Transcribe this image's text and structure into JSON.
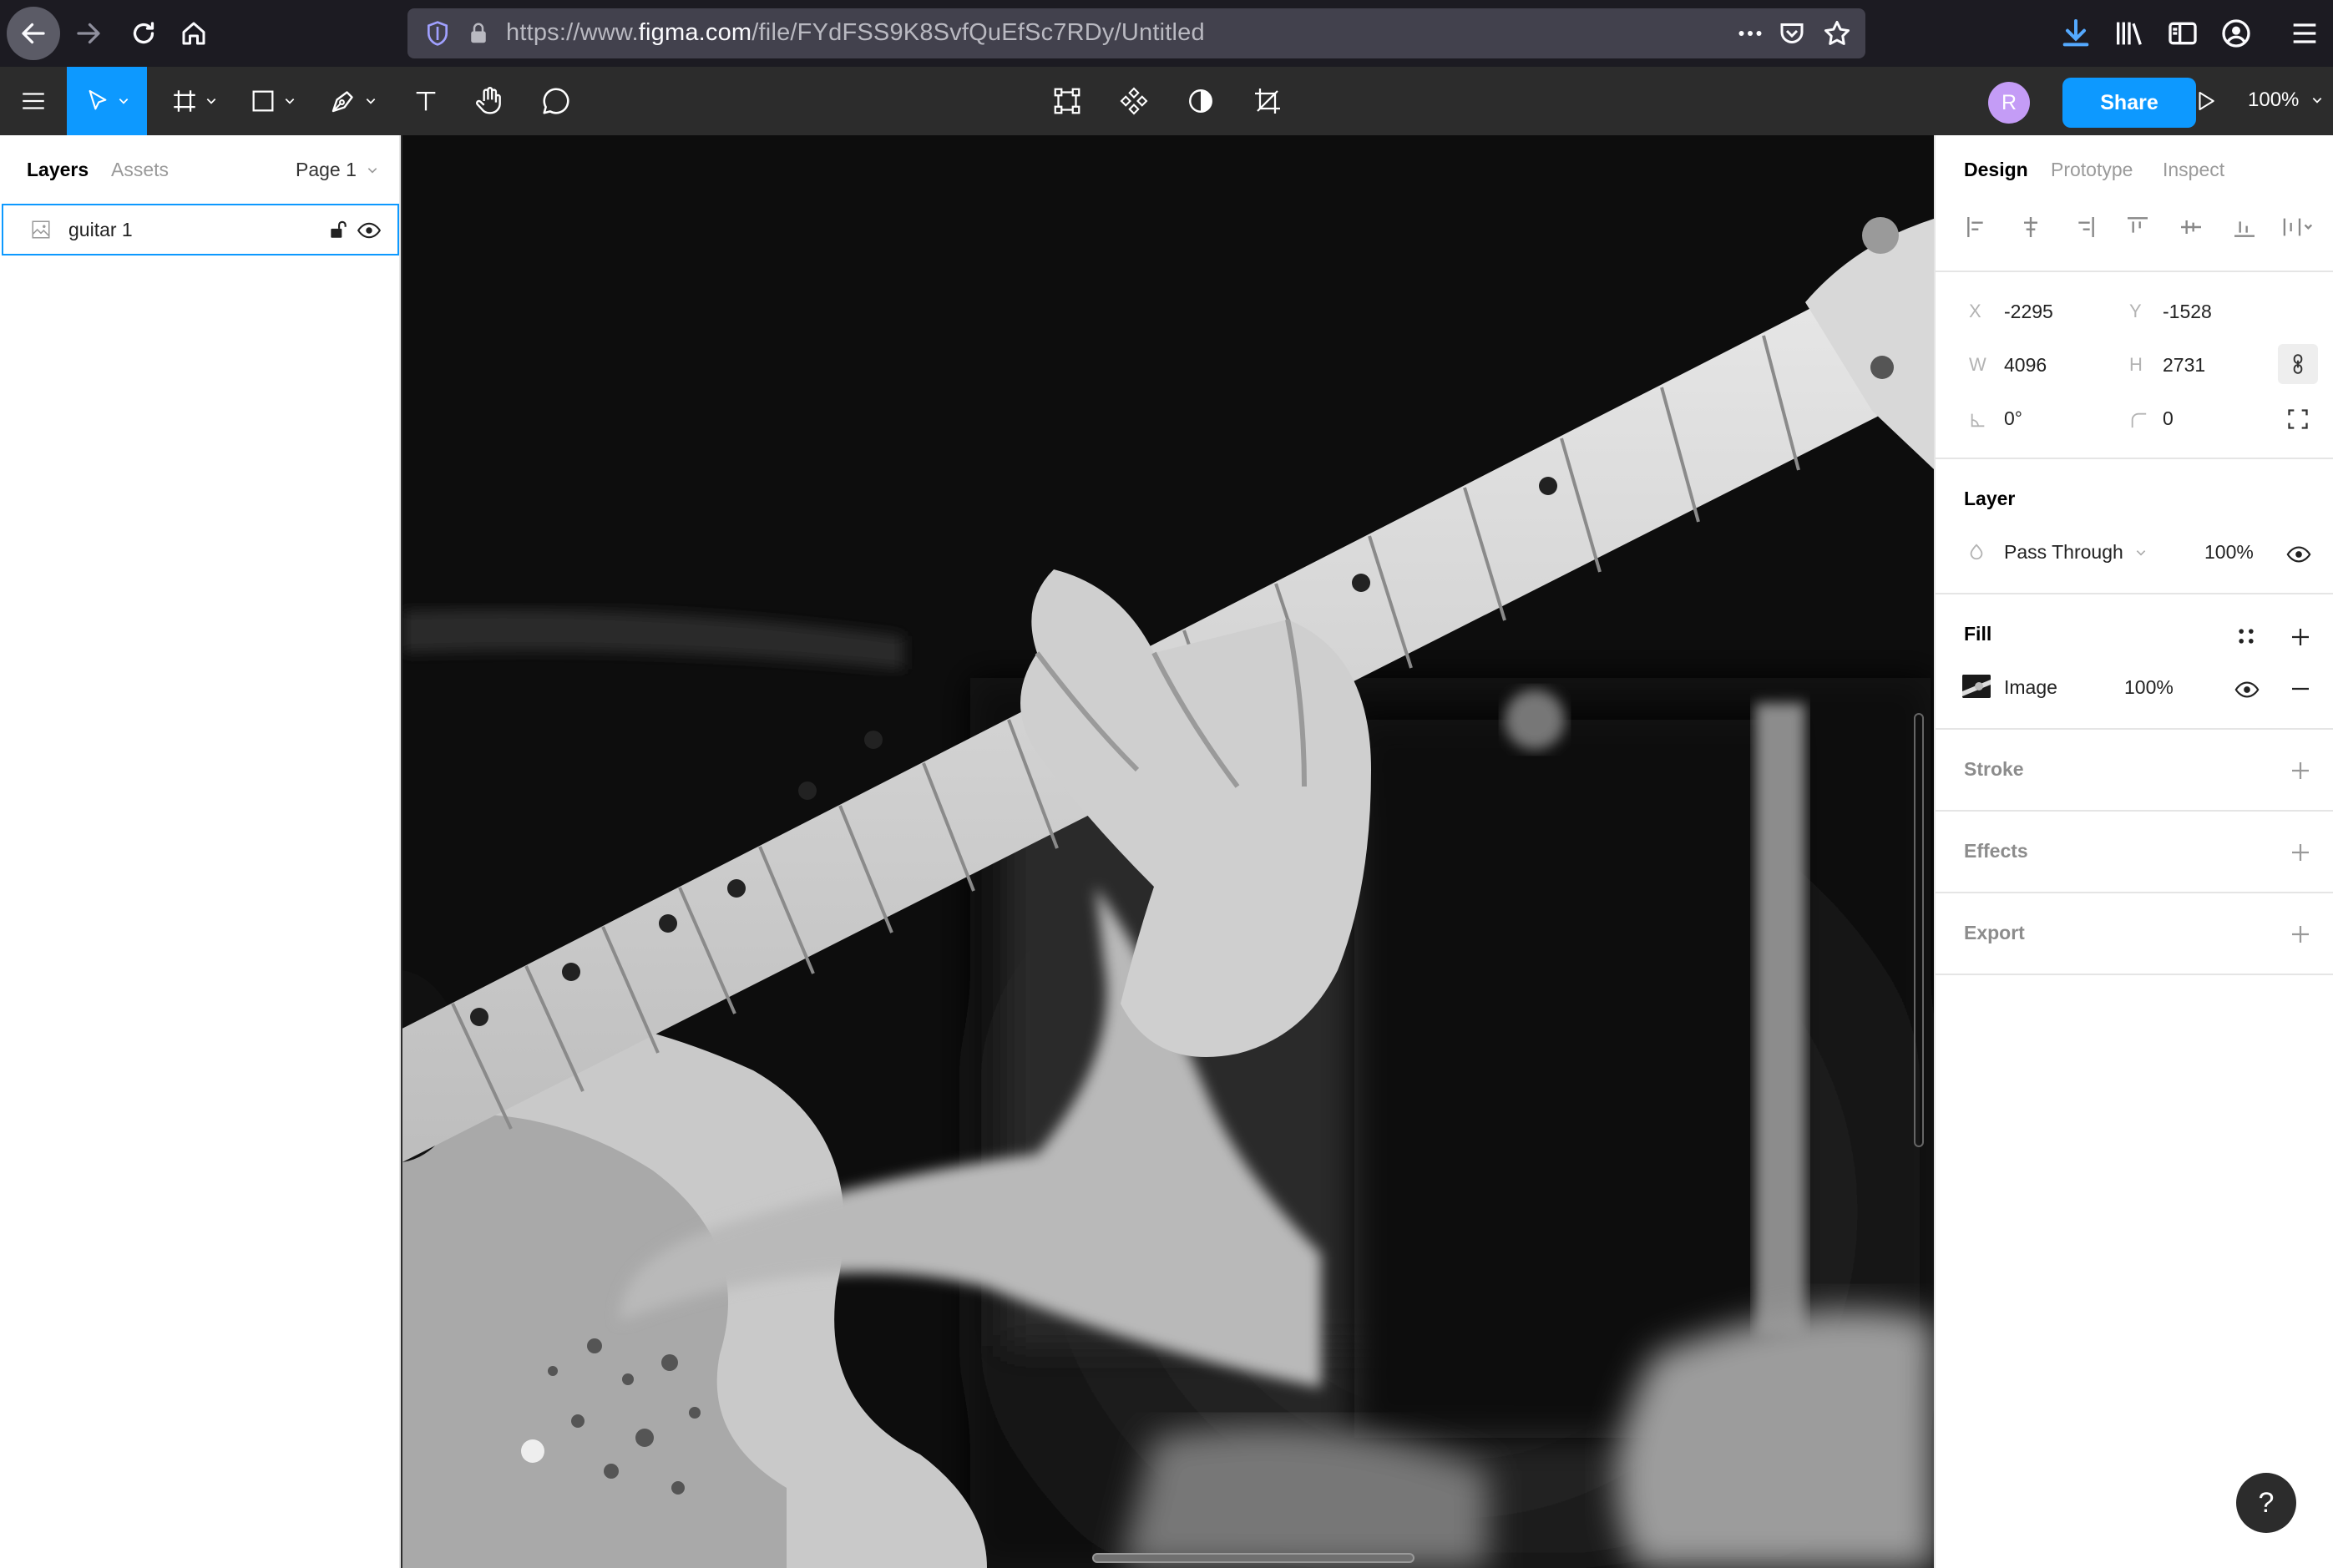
{
  "browser": {
    "url_prefix": "https://www.",
    "url_domain": "figma.com",
    "url_path": "/file/FYdFSS9K8SvfQuEfSc7RDy/Untitled"
  },
  "toolbar": {
    "avatar_initial": "R",
    "share_label": "Share",
    "zoom": "100%"
  },
  "left_panel": {
    "tabs": [
      {
        "label": "Layers",
        "active": true
      },
      {
        "label": "Assets",
        "active": false
      }
    ],
    "page": "Page 1",
    "layers": [
      {
        "name": "guitar 1",
        "type": "image",
        "selected": true
      }
    ]
  },
  "right_panel": {
    "tabs": [
      {
        "label": "Design",
        "active": true
      },
      {
        "label": "Prototype",
        "active": false
      },
      {
        "label": "Inspect",
        "active": false
      }
    ],
    "geometry": {
      "x_label": "X",
      "x": "-2295",
      "y_label": "Y",
      "y": "-1528",
      "w_label": "W",
      "w": "4096",
      "h_label": "H",
      "h": "2731",
      "rotation": "0°",
      "corner_radius": "0"
    },
    "layer": {
      "title": "Layer",
      "blend_mode": "Pass Through",
      "opacity": "100%"
    },
    "fill": {
      "title": "Fill",
      "type": "Image",
      "opacity": "100%"
    },
    "sections": [
      "Stroke",
      "Effects",
      "Export"
    ]
  },
  "help_label": "?",
  "colors": {
    "accent": "#0d99ff",
    "toolbar_bg": "#2c2c2c",
    "browser_bg": "#1c1b22",
    "avatar": "#c49cf6"
  }
}
